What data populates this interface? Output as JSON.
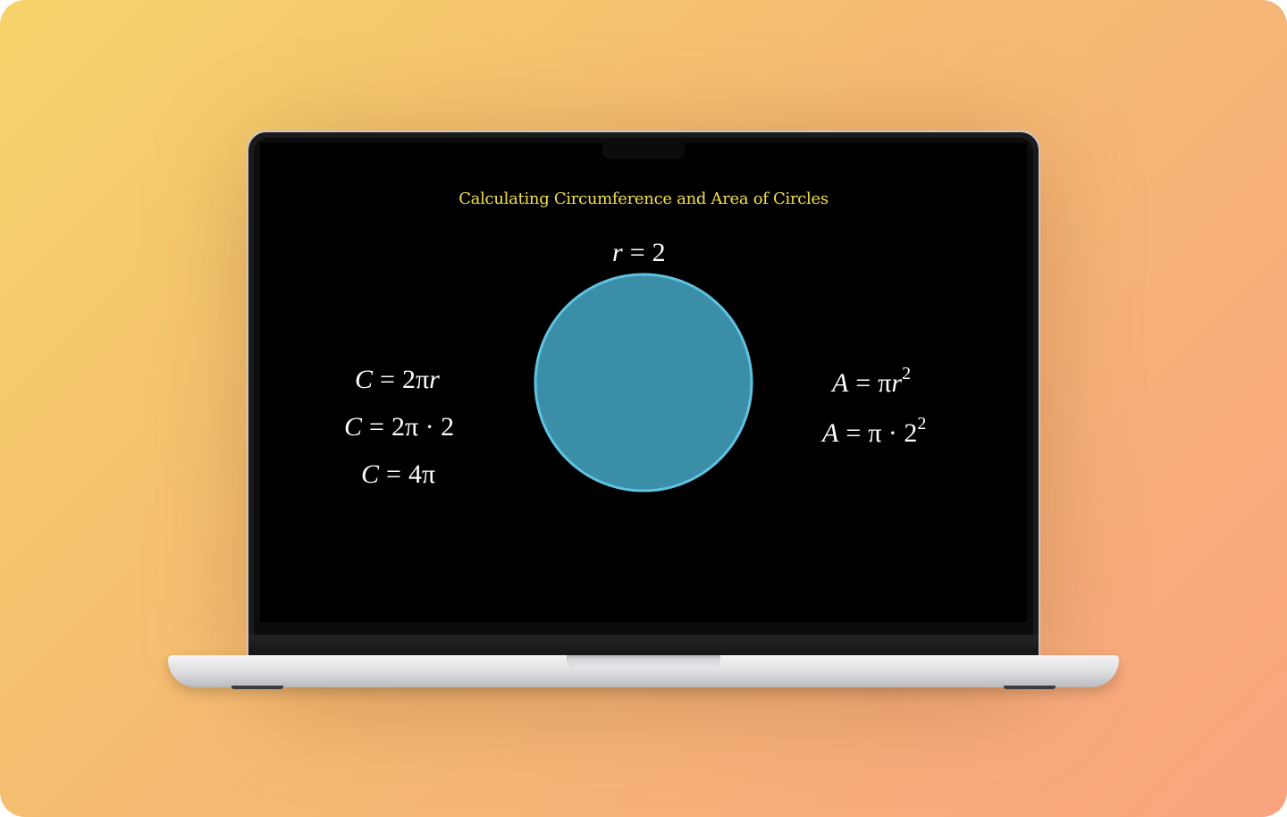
{
  "slide": {
    "title": "Calculating Circumference and Area of Circles",
    "radius_label": {
      "var": "r",
      "op": "=",
      "val": "2"
    },
    "circumference": [
      {
        "lhs": "C",
        "op": "=",
        "rhs_pre": "2π",
        "rhs_var": "r",
        "rhs_post": ""
      },
      {
        "lhs": "C",
        "op": "=",
        "rhs_pre": "2π · 2",
        "rhs_var": "",
        "rhs_post": ""
      },
      {
        "lhs": "C",
        "op": "=",
        "rhs_pre": "4π",
        "rhs_var": "",
        "rhs_post": ""
      }
    ],
    "area": [
      {
        "lhs": "A",
        "op": "=",
        "rhs_pre": "π",
        "rhs_var": "r",
        "sup": "2"
      },
      {
        "lhs": "A",
        "op": "=",
        "rhs_pre": "π · 2",
        "rhs_var": "",
        "sup": "2"
      }
    ],
    "circle": {
      "fill": "#3a8ea8",
      "stroke": "#5fc3e0"
    },
    "colors": {
      "title": "#f2e04a",
      "background": "#000000",
      "text": "#ffffff"
    }
  }
}
